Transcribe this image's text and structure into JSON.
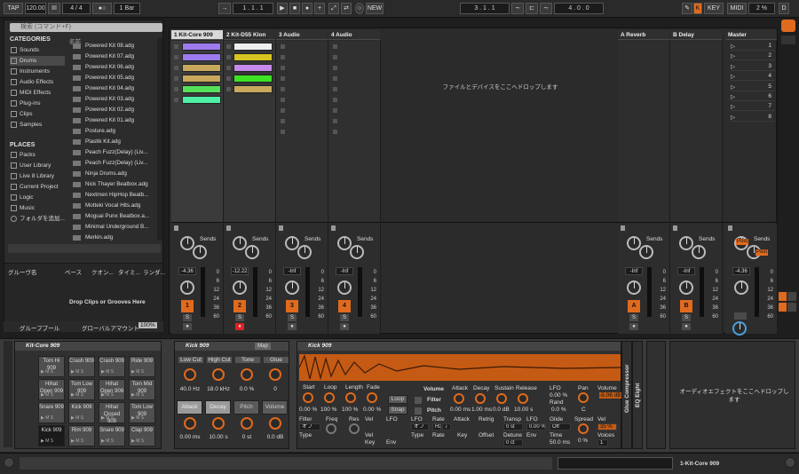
{
  "topbar": {
    "tap": "TAP",
    "tempo": "120.00",
    "metro": "III",
    "meter": "4 / 4",
    "circles": "●○",
    "quant": "1 Bar",
    "pos1": "1 .   1 .   1",
    "pos2": "3 .   1 .   1",
    "pos3": "4 .   0 .   0",
    "new": "NEW",
    "key": "KEY",
    "midi": "MIDI",
    "cpu": "2 %",
    "d": "D"
  },
  "browser": {
    "search_placeholder": "検索 (コマンド+F)",
    "name_header": "名前",
    "categories_title": "CATEGORIES",
    "categories": [
      "Sounds",
      "Drums",
      "Instruments",
      "Audio Effects",
      "MIDI Effects",
      "Plug-ins",
      "Clips",
      "Samples"
    ],
    "places_title": "PLACES",
    "places": [
      "Packs",
      "User Library",
      "Live 8 Library",
      "Current Project",
      "Logic",
      "Music",
      "フォルダを追加..."
    ],
    "files": [
      "Powered Kit 08.adg",
      "Powered Kit 07.adg",
      "Powered Kit 06.adg",
      "Powered Kit 05.adg",
      "Powered Kit 04.adg",
      "Powered Kit 03.adg",
      "Powered Kit 02.adg",
      "Powered Kit 01.adg",
      "Posture.adg",
      "Plastik Kit.adg",
      "Peach Fuzz(Delay) (Liv...",
      "Peach Fuzz(Delay) (Liv...",
      "Ninja Drums.adg",
      "Nick Thayer Beatbox.adg",
      "Nextmen HipHop Beatb...",
      "Motteki Vocal Hits.adg",
      "Moguai Punx Beatbox.a...",
      "Minimal Underground B...",
      "Merkin.adg"
    ]
  },
  "groove": {
    "headers": [
      "グルーヴ名",
      "ベース",
      "クオン...",
      "タイミ...",
      "ランダ..."
    ],
    "drop": "Drop Clips or Grooves Here",
    "pool": "グループプール",
    "global": "グローバルアマウント",
    "global_val": "100%"
  },
  "session": {
    "tracks": [
      "1 Kit-Core 909",
      "2 Kit-D55 Klon",
      "3 Audio",
      "4 Audio"
    ],
    "returns": [
      "A Reverb",
      "B Delay"
    ],
    "master": "Master",
    "drop": "ファイルとデバイスをここへドロップします",
    "scenes": [
      "1",
      "2",
      "3",
      "4",
      "5",
      "6",
      "7",
      "8"
    ],
    "sends": "Sends",
    "volumes": [
      "-4.36",
      "-12.22",
      "-Inf",
      "-Inf",
      "-Inf",
      "-Inf",
      "-4.36"
    ],
    "numbers": [
      "1",
      "2",
      "3",
      "4",
      "A",
      "B"
    ],
    "scale": [
      "0",
      "6",
      "12",
      "24",
      "36",
      "60"
    ],
    "post": "Post",
    "clip_colors1": [
      "#9d7bee",
      "#9d7bee",
      "#c7a85d",
      "#c7a85d",
      "#55e05a",
      "#4df0a4"
    ],
    "clip_colors2": [
      "#efefef",
      "#d6c421",
      "#c68aec",
      "#3ee224",
      "#c7a85d"
    ]
  },
  "drumrack": {
    "title": "Kit-Core 909",
    "pads": [
      "Tom Hi 909",
      "Crash 909",
      "Crash 909",
      "Ride 909",
      "Hihat Open 909",
      "Tom Low 909",
      "Hihat Open 909",
      "Tom Mid 909",
      "Snare 909",
      "Kick 909",
      "Hihat Closed 909",
      "Tom Low 909",
      "Kick 909",
      "Rim 909",
      "Snare 909",
      "Clap 909"
    ]
  },
  "kick": {
    "title": "Kick 909",
    "map": "Map",
    "labels": [
      "Low Cut",
      "High Cut",
      "Tone",
      "Glue"
    ],
    "values": [
      "40.0 Hz",
      "18.0 kHz",
      "0.0 %",
      "0"
    ],
    "buttons": [
      "Attack",
      "Decay",
      "Pitch",
      "Volume"
    ],
    "values2": [
      "0.00 ms",
      "10.00 s",
      "0 st",
      "0.0 dB"
    ]
  },
  "sampler": {
    "title": "Kick 909",
    "row1": [
      "Start",
      "Loop",
      "Length",
      "Fade"
    ],
    "row1v": [
      "0.00 %",
      "100 %",
      "100 %",
      "0.00 %"
    ],
    "loop": "Loop",
    "snap": "Snap",
    "vol_hdr": "Volume",
    "filter": "Filter",
    "pitch": "Pitch",
    "env": [
      "Attack",
      "Decay",
      "Sustain",
      "Release"
    ],
    "envv": [
      "0.00 ms",
      "1.00 ms",
      "0.0 dB",
      "10.00 s"
    ],
    "lfo": "LFO",
    "lfo_v": "0.00 %",
    "rand": "Rand",
    "rand_v": "0.0 %",
    "pan": "Pan",
    "pan_v": "C",
    "volume": "Volume",
    "volume_v": "-8.06 dB",
    "row3": [
      "Filter",
      "Freq",
      "Res",
      "Vel",
      "LFO",
      "LFO",
      "Rate",
      "Attack",
      "Retrig",
      "Transp",
      "LFO",
      "Glide",
      "Spread",
      "Vel"
    ],
    "ftype": "オフ",
    "type": "Type",
    "hz": "Hz",
    "note": "♪",
    "transp_v": "0 st",
    "lfo_pitch": "0.00 %",
    "glide_v": "Off",
    "time": "Time",
    "time_v": "50.0 ms",
    "spread_v": "0 %",
    "vel_v": "35 %",
    "voices": "Voices",
    "voices_v": "1",
    "key": "Key",
    "env_l": "Env",
    "offset": "Offset",
    "detune": "Detune",
    "detune_v": "0 ct",
    "glue": "Glue Compressor",
    "eq": "EQ Eight"
  },
  "audio_drop": "オーディオエフェクトをここへドロップします",
  "status": {
    "track": "1-Kit-Core 909"
  }
}
